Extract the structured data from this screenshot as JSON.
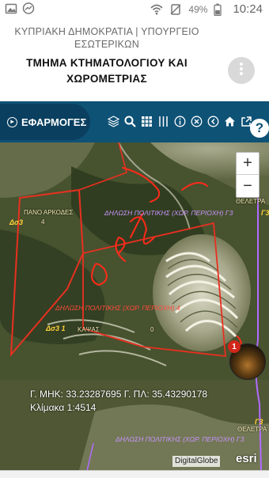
{
  "statusbar": {
    "time": "10:24",
    "battery": "49%",
    "icons": [
      "image-icon",
      "messenger-icon",
      "wifi-icon",
      "mute-icon",
      "battery-icon"
    ]
  },
  "header": {
    "ministry": "ΚΥΠΡΙΑΚΗ ΔΗΜΟΚΡΑΤΙΑ | ΥΠΟΥΡΓΕΙΟ ΕΣΩΤΕΡΙΚΩΝ",
    "department": "ΤΜΗΜΑ ΚΤΗΜΑΤΟΛΟΓΙΟΥ ΚΑΙ ΧΩΡΟΜΕΤΡΙΑΣ",
    "menu_icon": "more-vertical-icon"
  },
  "toolbar": {
    "apps_label": "ΕΦΑΡΜΟΓΕΣ",
    "tools": [
      "layers-icon",
      "search-icon",
      "grid-icon",
      "list-icon",
      "info-icon",
      "clear-icon",
      "back-icon",
      "home-icon",
      "external-link-icon"
    ],
    "help": "?"
  },
  "map": {
    "zoom_in": "+",
    "zoom_out": "−",
    "labels": {
      "papageorgiou": "ΠΑΝΟ ΑΡΚΟΔΕΣ",
      "sector_top_num": "4",
      "block_top": "Δσ3",
      "declaration_top": "ΔΗΛΩΣΗ ΠΟΛΙΤΙΚΗΣ (ΧΩΡ. ΠΕΡΙΟΧΗ) Γ3",
      "declaration_mid": "ΔΗΛΩΣΗ ΠΟΛΙΤΙΚΗΣ (ΧΩΡ. ΠΕΡΙΟΧΗ) 4",
      "block_mid": "Δσ3 1",
      "kapsas": "ΚΑΨΑΣ",
      "zero": "0",
      "right_small": "ΘΕΛΕΤΡΑ",
      "gamma": "Γ3",
      "declaration_bottom": "ΔΗΛΩΣΗ ΠΟΛΙΤΙΚΗΣ (ΧΩΡ. ΠΕΡΙΟΧΗ) Γ3",
      "right_small_bottom": "ΘΕΛΕΤΡΑ",
      "gamma_bottom": "Γ3"
    },
    "coords_line1": "Γ. ΜΗΚ: 33.23287695 Γ. ΠΛ: 35.43290178",
    "coords_line2": "Κλίμακα 1:4514",
    "badge_count": "1",
    "attribution": "DigitalGlobe",
    "provider": "esri"
  }
}
